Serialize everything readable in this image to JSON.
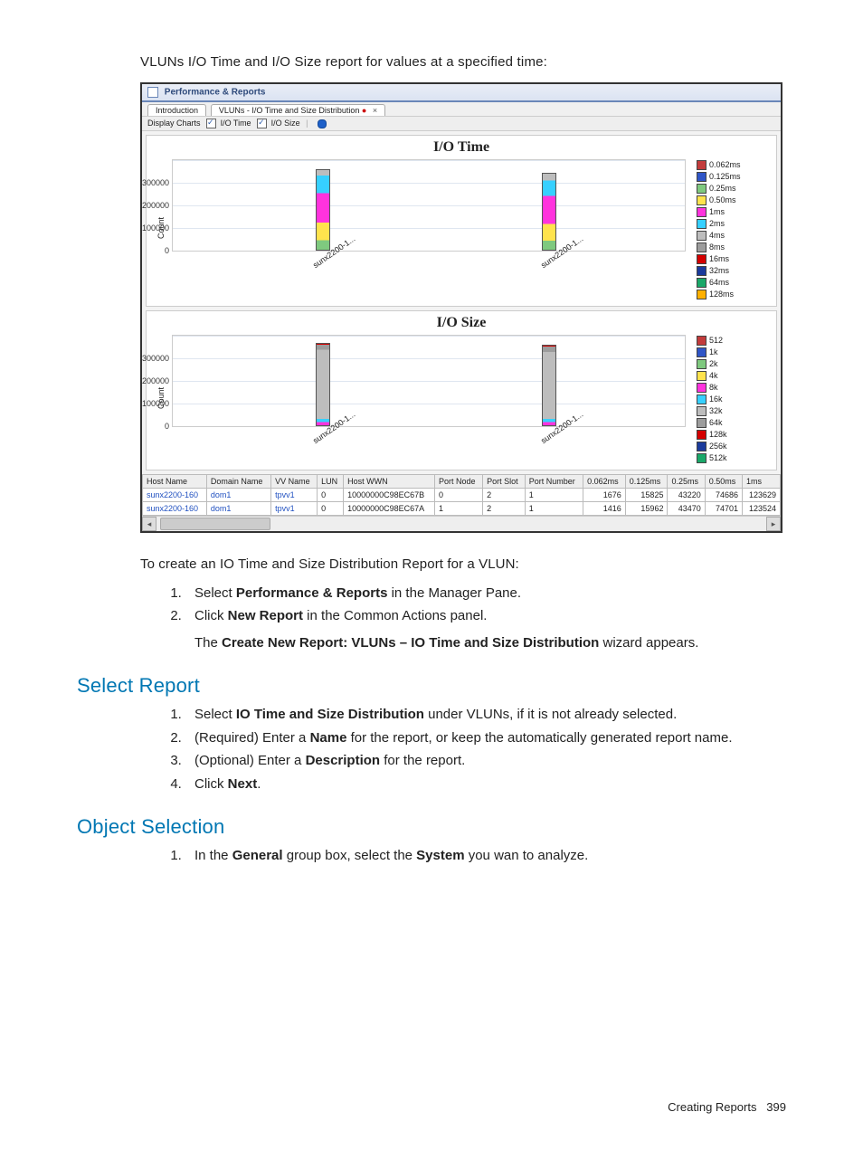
{
  "caption": "VLUNs I/O Time and I/O Size report for values at a specified time:",
  "shot": {
    "window_title": "Performance & Reports",
    "tabs": {
      "intro": "Introduction",
      "active": "VLUNs - I/O Time and Size Distribution",
      "active_dot": "●",
      "close": "×"
    },
    "toolbar": {
      "label": "Display Charts",
      "cb1": "I/O Time",
      "cb2": "I/O Size"
    }
  },
  "chart_data": [
    {
      "type": "bar",
      "title": "I/O Time",
      "ylabel": "Count",
      "yticks": [
        0,
        100000,
        200000,
        300000
      ],
      "categories": [
        "sunx2200-1...",
        "sunx2200-1..."
      ],
      "note": "Stacked bars per host; heights per bucket approximated from pixels",
      "series": [
        {
          "name": "0.062ms",
          "color": "#c23b3b",
          "values": [
            200,
            200
          ]
        },
        {
          "name": "0.125ms",
          "color": "#2f55c7",
          "values": [
            1800,
            1600
          ]
        },
        {
          "name": "0.25ms",
          "color": "#7fc97f",
          "values": [
            43000,
            43000
          ]
        },
        {
          "name": "0.50ms",
          "color": "#ffe34d",
          "values": [
            75000,
            75000
          ]
        },
        {
          "name": "1ms",
          "color": "#ff33dd",
          "values": [
            123000,
            123000
          ]
        },
        {
          "name": "2ms",
          "color": "#36d0ff",
          "values": [
            80000,
            72000
          ]
        },
        {
          "name": "4ms",
          "color": "#bdbdbd",
          "values": [
            12000,
            16000
          ]
        },
        {
          "name": "8ms",
          "color": "#9c9c9c",
          "values": [
            2000,
            2500
          ]
        },
        {
          "name": "16ms",
          "color": "#d40000",
          "values": [
            500,
            500
          ]
        },
        {
          "name": "32ms",
          "color": "#1b3b9c",
          "values": [
            200,
            200
          ]
        },
        {
          "name": "64ms",
          "color": "#1aa869",
          "values": [
            50,
            50
          ]
        },
        {
          "name": "128ms",
          "color": "#ffb000",
          "values": [
            20,
            20
          ]
        }
      ]
    },
    {
      "type": "bar",
      "title": "I/O Size",
      "ylabel": "Count",
      "yticks": [
        0,
        100000,
        200000,
        300000
      ],
      "categories": [
        "sunx2200-1...",
        "sunx2200-1..."
      ],
      "series": [
        {
          "name": "512",
          "color": "#c23b3b",
          "values": [
            500,
            500
          ]
        },
        {
          "name": "1k",
          "color": "#2f55c7",
          "values": [
            1200,
            1200
          ]
        },
        {
          "name": "2k",
          "color": "#7fc97f",
          "values": [
            2000,
            2000
          ]
        },
        {
          "name": "4k",
          "color": "#ffe34d",
          "values": [
            4000,
            4000
          ]
        },
        {
          "name": "8k",
          "color": "#ff33dd",
          "values": [
            8000,
            8000
          ]
        },
        {
          "name": "16k",
          "color": "#36d0ff",
          "values": [
            8000,
            8000
          ]
        },
        {
          "name": "32k",
          "color": "#bdbdbd",
          "values": [
            310000,
            300000
          ]
        },
        {
          "name": "64k",
          "color": "#9c9c9c",
          "values": [
            12000,
            14000
          ]
        },
        {
          "name": "128k",
          "color": "#d40000",
          "values": [
            2000,
            2000
          ]
        },
        {
          "name": "256k",
          "color": "#1b3b9c",
          "values": [
            300,
            300
          ]
        },
        {
          "name": "512k",
          "color": "#1aa869",
          "values": [
            100,
            100
          ]
        }
      ]
    }
  ],
  "table": {
    "headers": [
      "Host Name",
      "Domain Name",
      "VV Name",
      "LUN",
      "Host WWN",
      "Port Node",
      "Port Slot",
      "Port Number",
      "0.062ms",
      "0.125ms",
      "0.25ms",
      "0.50ms",
      "1ms"
    ],
    "rows": [
      [
        "sunx2200-160",
        "dom1",
        "tpvv1",
        "0",
        "10000000C98EC67B",
        "0",
        "2",
        "1",
        "1676",
        "15825",
        "43220",
        "74686",
        "123629"
      ],
      [
        "sunx2200-160",
        "dom1",
        "tpvv1",
        "0",
        "10000000C98EC67A",
        "1",
        "2",
        "1",
        "1416",
        "15962",
        "43470",
        "74701",
        "123524"
      ]
    ]
  },
  "instr_intro": "To create an IO Time and Size Distribution Report for a VLUN:",
  "instr_steps": {
    "s1a": "Select ",
    "s1b": "Performance & Reports",
    "s1c": " in the Manager Pane.",
    "s2a": "Click ",
    "s2b": "New Report",
    "s2c": " in the Common Actions panel.",
    "s2sub_a": "The ",
    "s2sub_b": "Create New Report: VLUNs – IO Time and Size Distribution",
    "s2sub_c": " wizard appears."
  },
  "section1": "Select Report",
  "sr_steps": {
    "s1a": "Select ",
    "s1b": "IO Time and Size Distribution",
    "s1c": " under VLUNs, if it is not already selected.",
    "s2a": "(Required) Enter a ",
    "s2b": "Name",
    "s2c": " for the report, or keep the automatically generated report name.",
    "s3a": "(Optional) Enter a ",
    "s3b": "Description",
    "s3c": " for the report.",
    "s4a": "Click ",
    "s4b": "Next",
    "s4c": "."
  },
  "section2": "Object Selection",
  "os_steps": {
    "s1a": "In the ",
    "s1b": "General",
    "s1c": " group box, select the ",
    "s1d": "System",
    "s1e": " you wan to analyze."
  },
  "footer": {
    "label": "Creating Reports",
    "page": "399",
    "gap": "   "
  }
}
